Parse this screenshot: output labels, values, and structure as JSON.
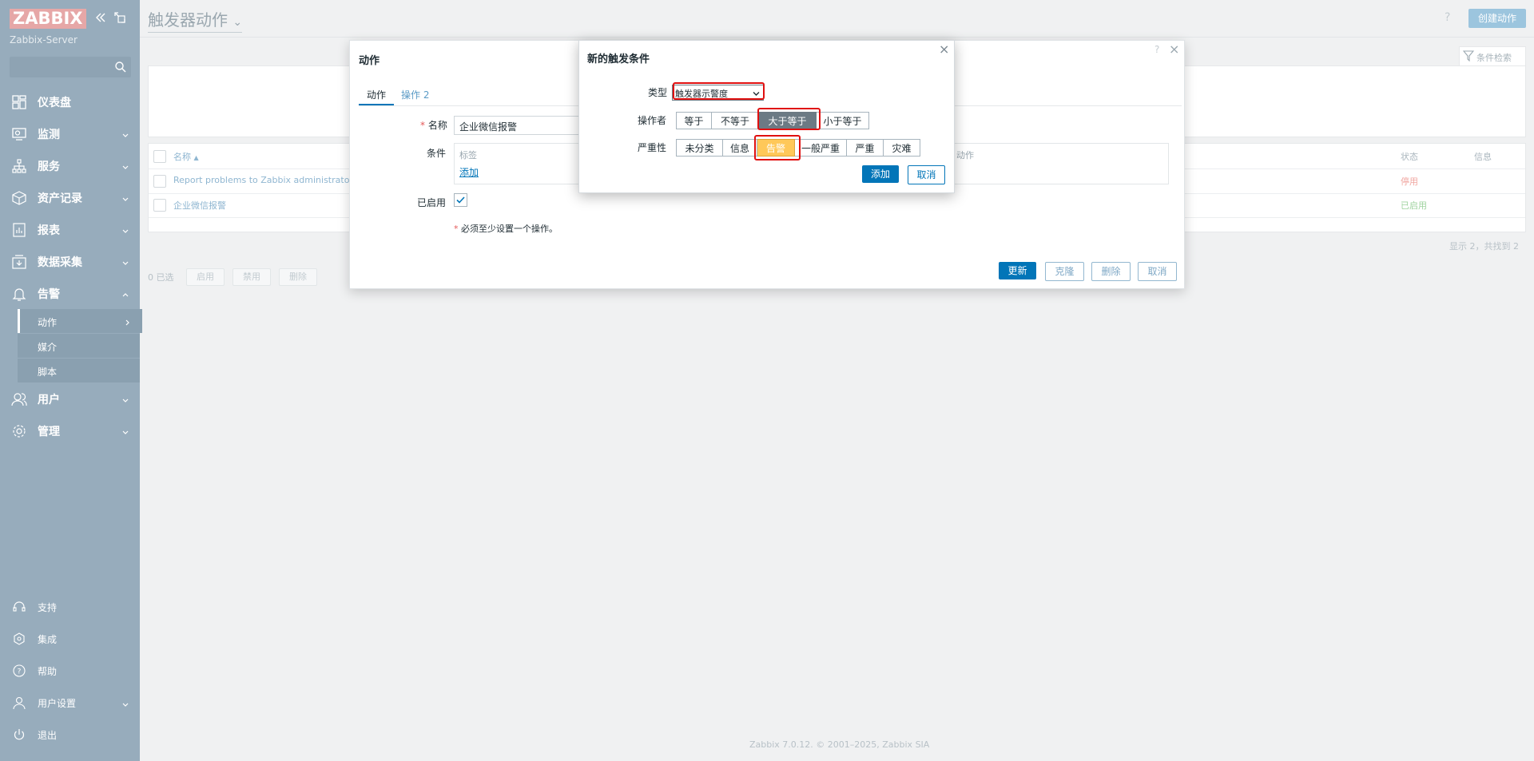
{
  "sidebar": {
    "logo": "ZABBIX",
    "server": "Zabbix-Server",
    "search_placeholder": "",
    "nav": [
      {
        "label": "仪表盘",
        "icon": "dashboard-icon"
      },
      {
        "label": "监测",
        "icon": "monitor-icon"
      },
      {
        "label": "服务",
        "icon": "services-icon"
      },
      {
        "label": "资产记录",
        "icon": "inventory-icon"
      },
      {
        "label": "报表",
        "icon": "reports-icon"
      },
      {
        "label": "数据采集",
        "icon": "data-collection-icon"
      },
      {
        "label": "告警",
        "icon": "bell-icon"
      },
      {
        "label": "用户",
        "icon": "users-icon"
      },
      {
        "label": "管理",
        "icon": "gear-icon"
      }
    ],
    "alerts_sub": [
      {
        "label": "动作"
      },
      {
        "label": "媒介"
      },
      {
        "label": "脚本"
      }
    ],
    "footer": [
      {
        "label": "支持",
        "icon": "headset-icon"
      },
      {
        "label": "集成",
        "icon": "integrations-icon"
      },
      {
        "label": "帮助",
        "icon": "help-icon"
      },
      {
        "label": "用户设置",
        "icon": "user-icon"
      },
      {
        "label": "退出",
        "icon": "power-icon"
      }
    ]
  },
  "header": {
    "title": "触发器动作",
    "help": "?",
    "create_button": "创建动作",
    "filter_label": "条件检索"
  },
  "table": {
    "col_name": "名称",
    "col_sort": "▲",
    "col_actions": "动作",
    "col_status": "状态",
    "col_info": "信息",
    "rows": [
      {
        "name": "Report problems to Zabbix administrators",
        "status": "停用"
      },
      {
        "name": "企业微信报警",
        "status": "已启用"
      }
    ],
    "summary": "显示 2，共找到 2",
    "selected": "0 已选",
    "bulk_enable": "启用",
    "bulk_disable": "禁用",
    "bulk_delete": "删除"
  },
  "footer_text": "Zabbix 7.0.12. © 2001–2025, Zabbix SIA",
  "action_dialog": {
    "title": "动作",
    "help": "?",
    "close": "×",
    "tab_action": "动作",
    "tab_operations": "操作 2",
    "name_label": "名称",
    "required_mark": "*",
    "name_value": "企业微信报警",
    "conditions_label": "条件",
    "conditions_col_label": "标签",
    "conditions_col_action": "动作",
    "add_link": "添加",
    "enabled_label": "已启用",
    "enabled": true,
    "note": "必须至少设置一个操作。",
    "btn_update": "更新",
    "btn_clone": "克隆",
    "btn_delete": "删除",
    "btn_cancel": "取消"
  },
  "condition_dialog": {
    "title": "新的触发条件",
    "close": "×",
    "type_label": "类型",
    "type_value": "触发器示警度",
    "operator_label": "操作者",
    "operators": [
      "等于",
      "不等于",
      "大于等于",
      "小于等于"
    ],
    "operator_selected": "大于等于",
    "severity_label": "严重性",
    "severities": [
      "未分类",
      "信息",
      "告警",
      "一般严重",
      "严重",
      "灾难"
    ],
    "severity_selected": "告警",
    "selected_operator_color": "#6c7a84",
    "selected_severity_color": "#ffc859",
    "btn_add": "添加",
    "btn_cancel": "取消"
  }
}
